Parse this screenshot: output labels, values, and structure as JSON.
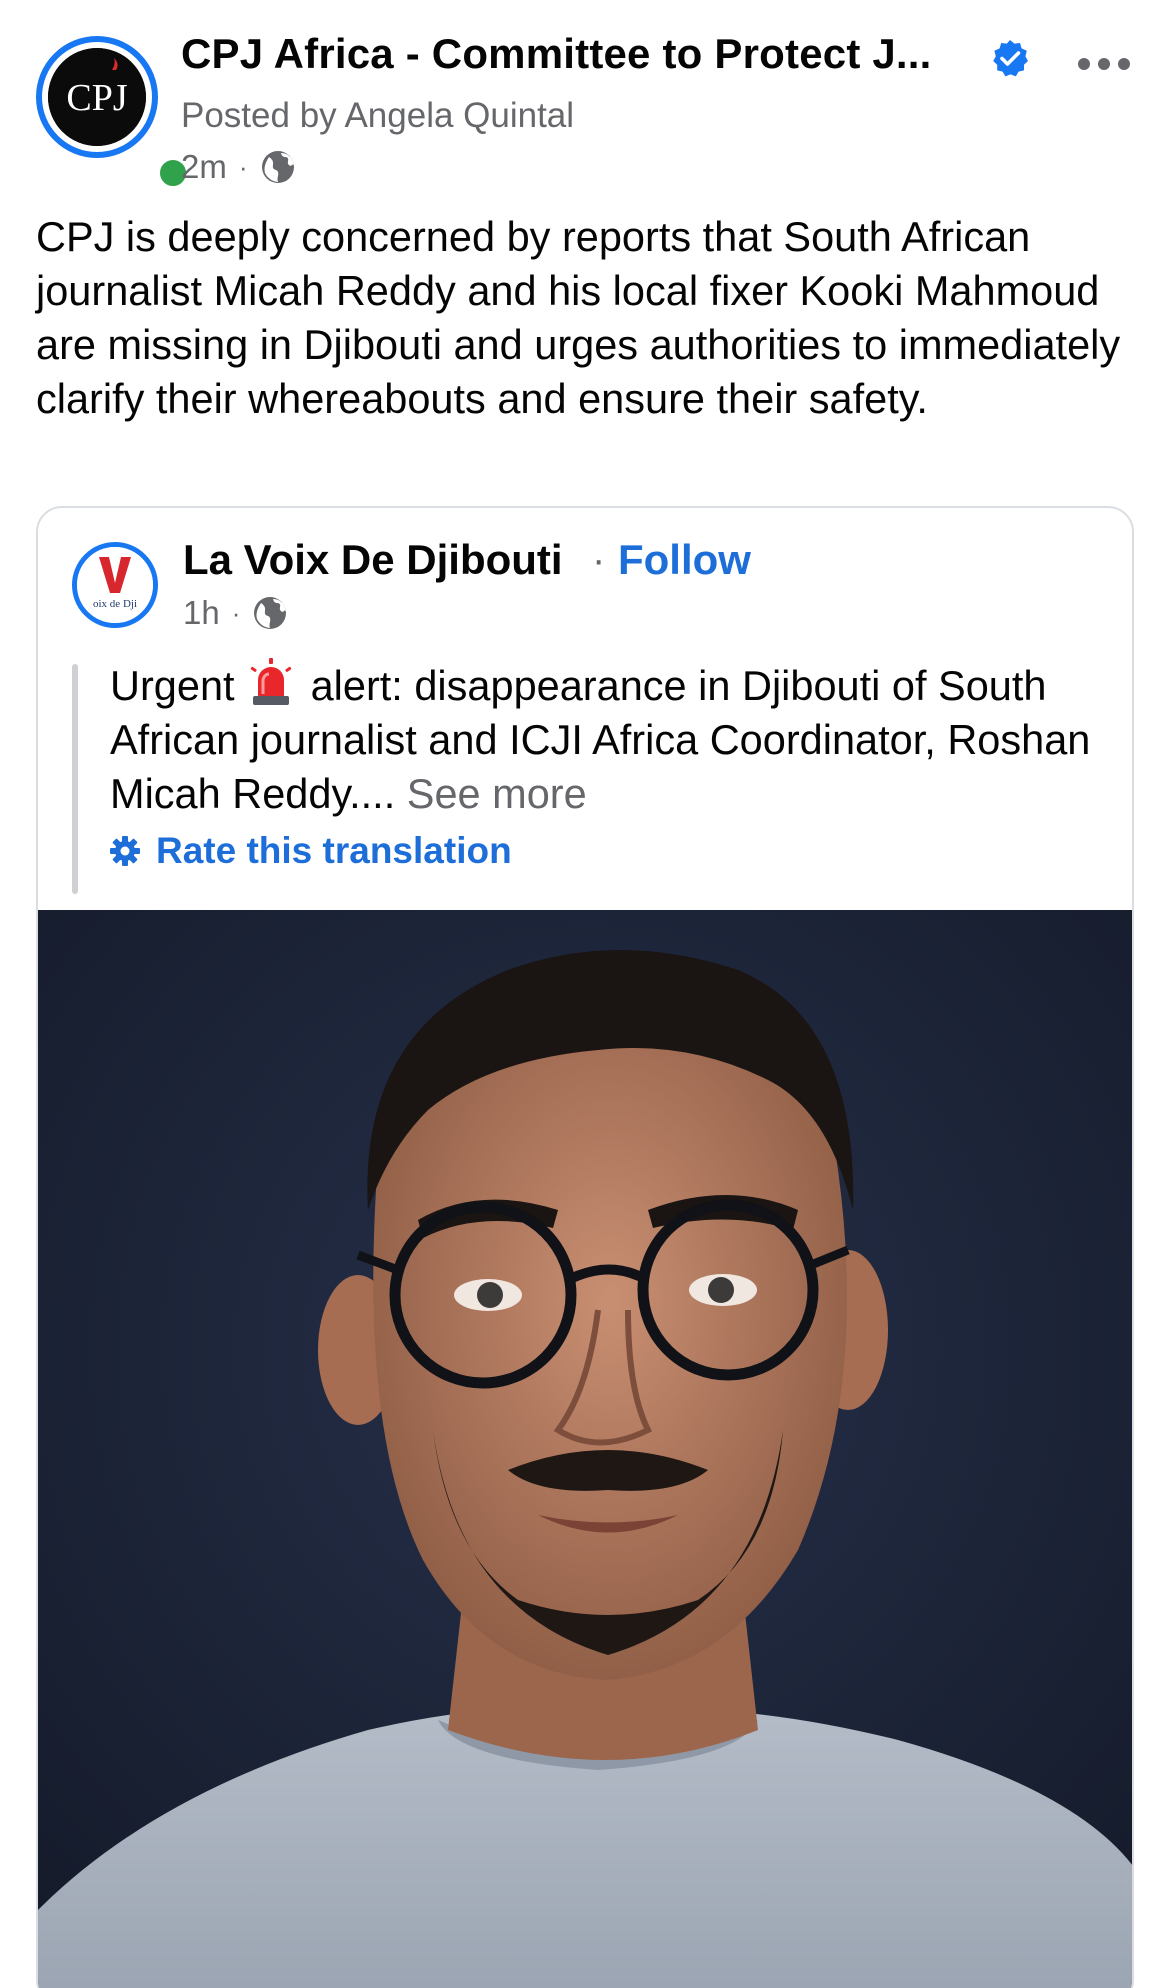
{
  "post": {
    "author_name": "CPJ Africa - Committee to Protect J...",
    "avatar_text": "CPJ",
    "posted_by": "Posted by Angela Quintal",
    "time": "2m",
    "separator": "·",
    "audience_icon": "globe-icon",
    "verified_icon": "verified-badge-icon",
    "more_icon": "more-options-icon",
    "text": "CPJ is deeply concerned by reports that South African journalist Micah Reddy and his local fixer Kooki Mahmoud are missing in Djibouti and urges authorities to immediately clarify their whereabouts and ensure their safety."
  },
  "shared_post": {
    "page_name": "La Voix De Djibouti",
    "separator": "·",
    "follow_label": "Follow",
    "avatar_text": "oix de Dji",
    "time": "1h",
    "audience_icon": "globe-icon",
    "text_before_icon": "Urgent",
    "alert_icon": "rotating-light-icon",
    "text_after_icon": "alert: disappearance in Djibouti of South African journalist and ICJI Africa Coordinator, Roshan Micah Reddy....",
    "see_more_label": "See more",
    "rate_translation_label": "Rate this translation",
    "rate_icon": "gear-icon",
    "image": "portrait-photo"
  },
  "colors": {
    "brand_blue": "#1877f2",
    "link_blue": "#1d6ed8",
    "secondary_text": "#65676b",
    "online_green": "#31a24c",
    "photo_background": "#1b2335",
    "shirt_gray": "#a9b2bf"
  }
}
